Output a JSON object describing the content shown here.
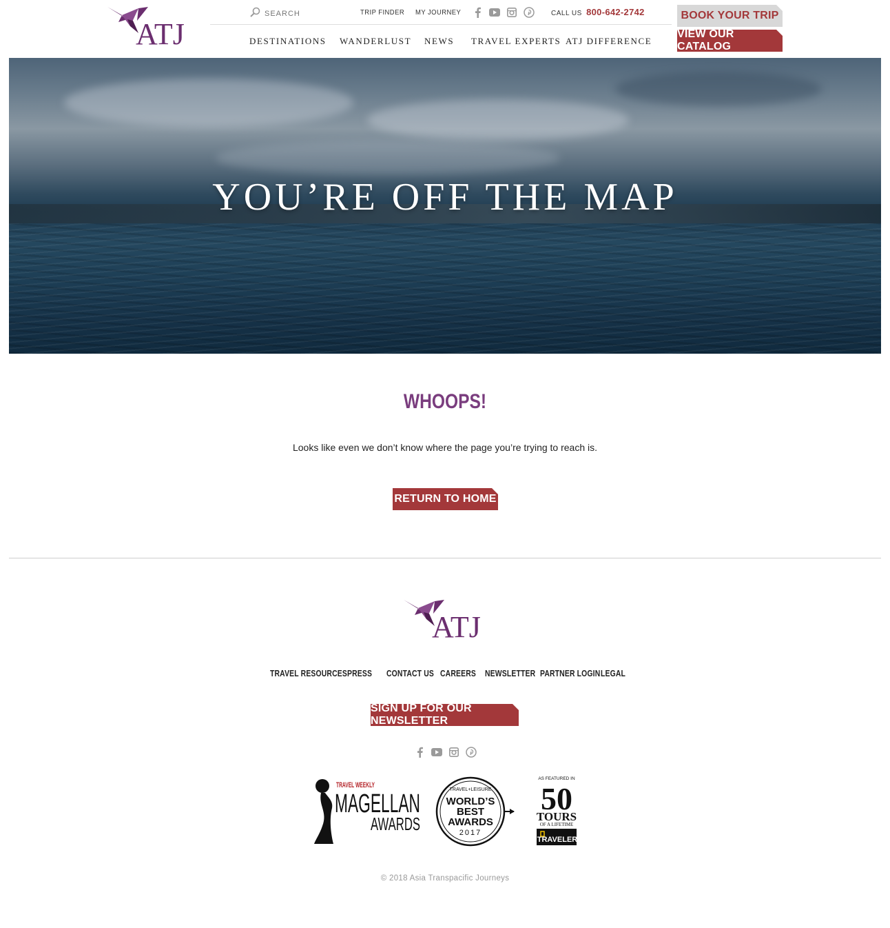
{
  "header": {
    "logo_text": "ATJ",
    "search": {
      "placeholder": "SEARCH"
    },
    "top_links": {
      "trip_finder": "TRIP FINDER",
      "my_journey": "MY JOURNEY"
    },
    "call": {
      "label": "CALL US",
      "phone": "800-642-2742"
    },
    "nav": [
      "DESTINATIONS",
      "WANDERLUST",
      "NEWS",
      "TRAVEL EXPERTS",
      "ATJ DIFFERENCE"
    ],
    "buttons": {
      "book_trip": "BOOK YOUR TRIP",
      "view_catalog": "VIEW OUR CATALOG"
    }
  },
  "hero": {
    "title": "YOU’RE OFF THE MAP"
  },
  "content": {
    "heading": "WHOOPS!",
    "message": "Looks like even we don’t know where the page you’re trying to reach is.",
    "return_button": "RETURN TO HOME"
  },
  "footer": {
    "links": [
      "TRAVEL RESOURCES",
      "PRESS",
      "CONTACT US",
      "CAREERS",
      "NEWSLETTER",
      "PARTNER LOGIN",
      "LEGAL"
    ],
    "newsletter_button": "SIGN UP FOR OUR NEWSLETTER",
    "awards": {
      "magellan": {
        "publisher": "TRAVEL WEEKLY",
        "line1": "MAGELLAN",
        "line2": "AWARDS"
      },
      "worlds_best": {
        "publisher": "TRAVEL+LEISURE",
        "line1": "WORLD’S",
        "line2": "BEST",
        "line3": "AWARDS",
        "year": "2017"
      },
      "fifty_tours": {
        "featured": "AS FEATURED IN",
        "number": "50",
        "line1": "TOURS",
        "line2": "OF A LIFETIME",
        "brand": "TRAVELER"
      }
    },
    "copyright": "© 2018 Asia Transpacific Journeys"
  },
  "colors": {
    "brand_purple": "#6b2e6f",
    "accent_red": "#a3383a",
    "grey_button": "#d8d8d8"
  },
  "icons": [
    "search-icon",
    "facebook-icon",
    "youtube-icon",
    "instagram-icon",
    "pinterest-icon"
  ]
}
